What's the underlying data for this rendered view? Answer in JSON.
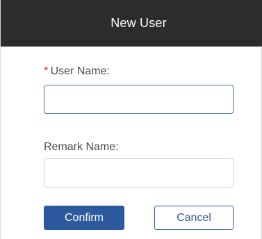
{
  "dialog": {
    "title": "New User"
  },
  "form": {
    "username": {
      "required_marker": "*",
      "label": "User Name:",
      "value": ""
    },
    "remark": {
      "label": "Remark Name:",
      "value": ""
    }
  },
  "actions": {
    "confirm_label": "Confirm",
    "cancel_label": "Cancel"
  },
  "colors": {
    "header_bg": "#2b2c2e",
    "primary": "#2d5a9e",
    "required": "#e03e2d"
  }
}
